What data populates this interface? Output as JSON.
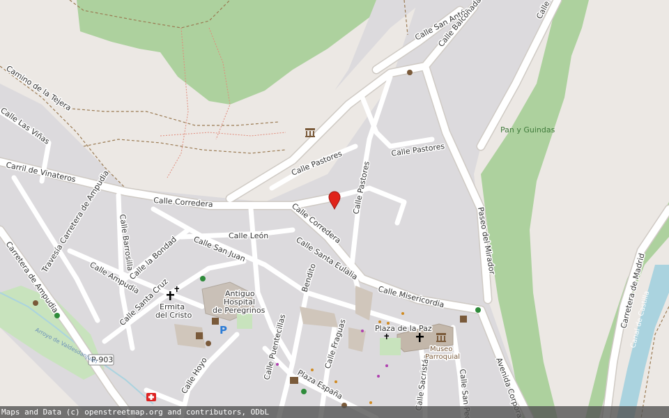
{
  "map": {
    "streets": {
      "camino_tejera": "Camino de la Tejera",
      "calle_vinas": "Calle Las Viñas",
      "carril_vinateros": "Carril de Vinateros",
      "calle_corredera_w": "Calle Corredera",
      "calle_corredera_e": "Calle Corredera",
      "calle_pastores_n": "Calle Pastores",
      "calle_pastores_e": "Calle Pastores",
      "calle_pastores_v": "Calle Pastores",
      "calle_san_anton": "Calle San Antón",
      "calle_balconada": "Calle Balconada",
      "calle_z": "Calle Z",
      "travesia_ampudia": "Travesía Carretera de Ampudia",
      "carretera_ampudia": "Carretera de Ampudia",
      "calle_barrosilla": "Calle Barrosilla",
      "calle_bondad": "Calle la Bondad",
      "calle_ampudia": "Calle Ampudia",
      "calle_leon": "Calle León",
      "calle_san_juan": "Calle San Juan",
      "calle_santa_eulalia": "Calle Santa Eulalia",
      "calle_santa_cruz": "Calle Santa Cruz",
      "calle_bendito": "Bendito",
      "calle_misericordia": "Calle Misericordia",
      "paseo_mirador": "Paseo del Mirador",
      "calle_puentecillas": "Calle Puentecillas",
      "calle_fraguas": "Calle Fraguas",
      "calle_hoyo": "Calle Hoyo",
      "plaza_espana": "Plaza España",
      "calle_sacristan": "Calle Sacristán",
      "calle_san_pedro": "Calle San Pedro",
      "avenida_corpora": "Avenida Corpora",
      "carretera_madrid": "Carretera de Madrid"
    },
    "places": {
      "plaza_paz": "Plaza de la Paz",
      "pan_guindas": "Pan y Guindas",
      "ermita_1": "Ermita",
      "ermita_2": "del Cristo",
      "hospital_1": "Antiguo",
      "hospital_2": "Hospital",
      "hospital_3": "de Peregrinos",
      "museo_1": "Museo",
      "museo_2": "Parroquial"
    },
    "water": {
      "arroyo": "Arroyo de Valdesdanjuan",
      "canal": "Canal de Castilla"
    },
    "road_ref": "P-903",
    "icons": {
      "marker": "map-pin-red",
      "church": "cross-icon",
      "museum": "museum-icon",
      "parking": "P",
      "colors": {
        "marker": "#e0231a",
        "parking": "#2b7bd6",
        "park": "#a8d39a",
        "water": "#aad3df"
      }
    }
  },
  "attribution": "Maps and Data (c) openstreetmap.org and contributors, ODbL"
}
